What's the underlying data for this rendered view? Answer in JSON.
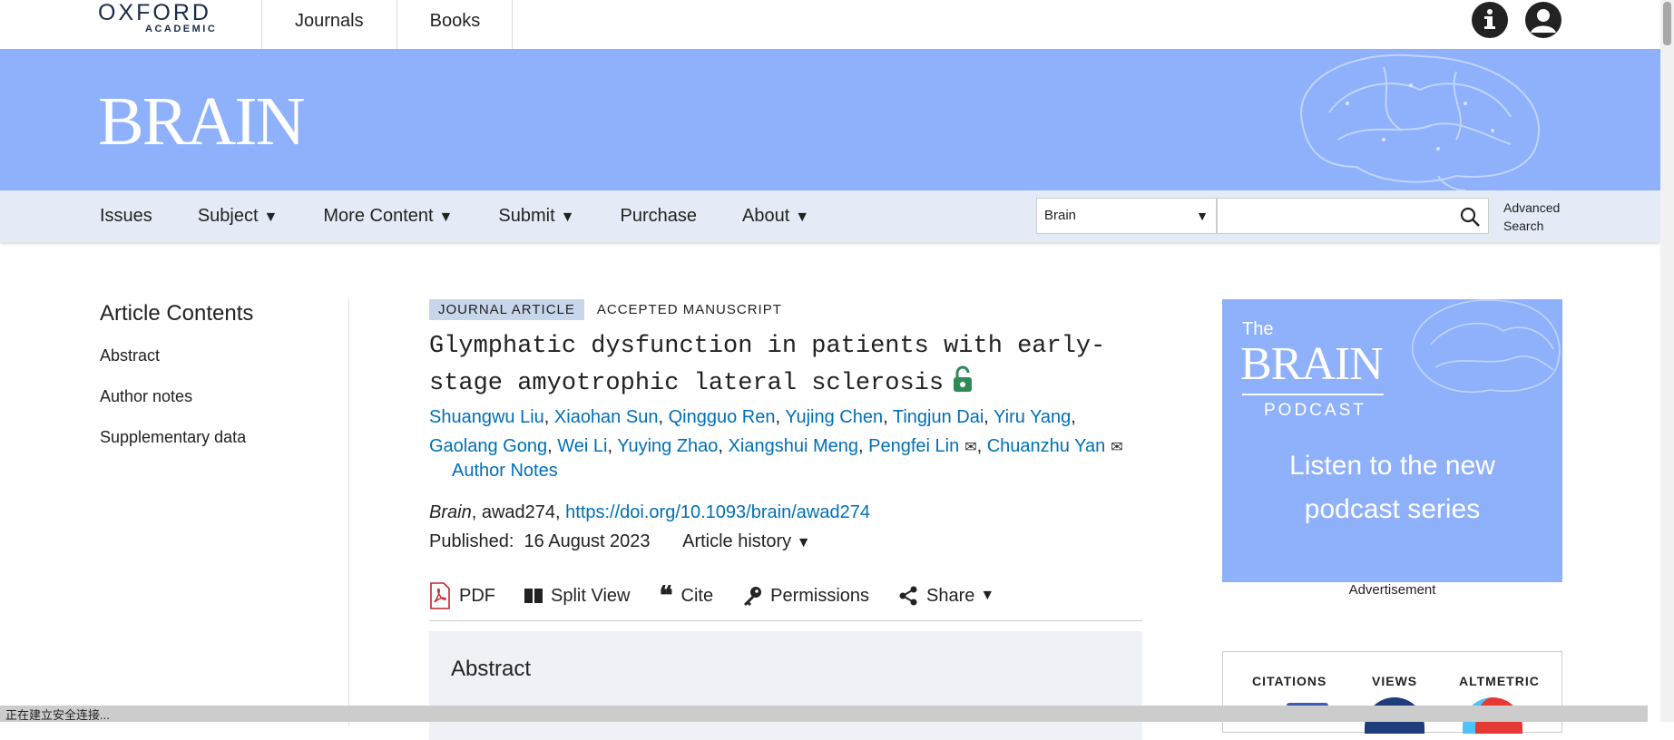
{
  "header": {
    "logo_main": "OXFORD",
    "logo_sub": "ACADEMIC",
    "nav": [
      "Journals",
      "Books"
    ],
    "icons": [
      "info-icon",
      "user-icon"
    ]
  },
  "banner": {
    "journal_name": "BRAIN"
  },
  "subnav": {
    "items": [
      "Issues",
      "Subject",
      "More Content",
      "Submit",
      "Purchase",
      "About"
    ],
    "has_dropdown": [
      false,
      true,
      true,
      true,
      false,
      true
    ],
    "search_scope": "Brain",
    "search_placeholder": "",
    "advanced_search": [
      "Advanced",
      "Search"
    ]
  },
  "sidebar": {
    "title": "Article Contents",
    "items": [
      "Abstract",
      "Author notes",
      "Supplementary data"
    ]
  },
  "article": {
    "type_tag": "JOURNAL ARTICLE",
    "status_tag": "ACCEPTED MANUSCRIPT",
    "title_line1": "Glymphatic dysfunction in patients with early-",
    "title_line2": "stage amyotrophic lateral sclerosis",
    "authors": [
      "Shuangwu Liu",
      "Xiaohan Sun",
      "Qingguo Ren",
      "Yujing Chen",
      "Tingjun Dai",
      "Yiru Yang",
      "Gaolang Gong",
      "Wei Li",
      "Yuying Zhao",
      "Xiangshui Meng",
      "Pengfei Lin",
      "Chuanzhu Yan"
    ],
    "author_notes": "Author Notes",
    "journal": "Brain",
    "article_id": "awad274",
    "doi": "https://doi.org/10.1093/brain/awad274",
    "published_label": "Published:",
    "published_date": "16 August 2023",
    "history_label": "Article history"
  },
  "toolbar": {
    "pdf": "PDF",
    "split": "Split View",
    "cite": "Cite",
    "permissions": "Permissions",
    "share": "Share"
  },
  "abstract": {
    "heading": "Abstract"
  },
  "ad": {
    "the": "The",
    "brain": "BRAIN",
    "podcast": "PODCAST",
    "line1": "Listen to the new",
    "line2": "podcast series",
    "label": "Advertisement"
  },
  "metrics": {
    "labels": [
      "CITATIONS",
      "VIEWS",
      "ALTMETRIC"
    ]
  },
  "status_bar": {
    "text": "正在建立安全连接..."
  },
  "colors": {
    "banner": "#8fb1fb",
    "link": "#006fb7",
    "subnav": "#e4ebf6",
    "lock": "#2e8b57"
  }
}
